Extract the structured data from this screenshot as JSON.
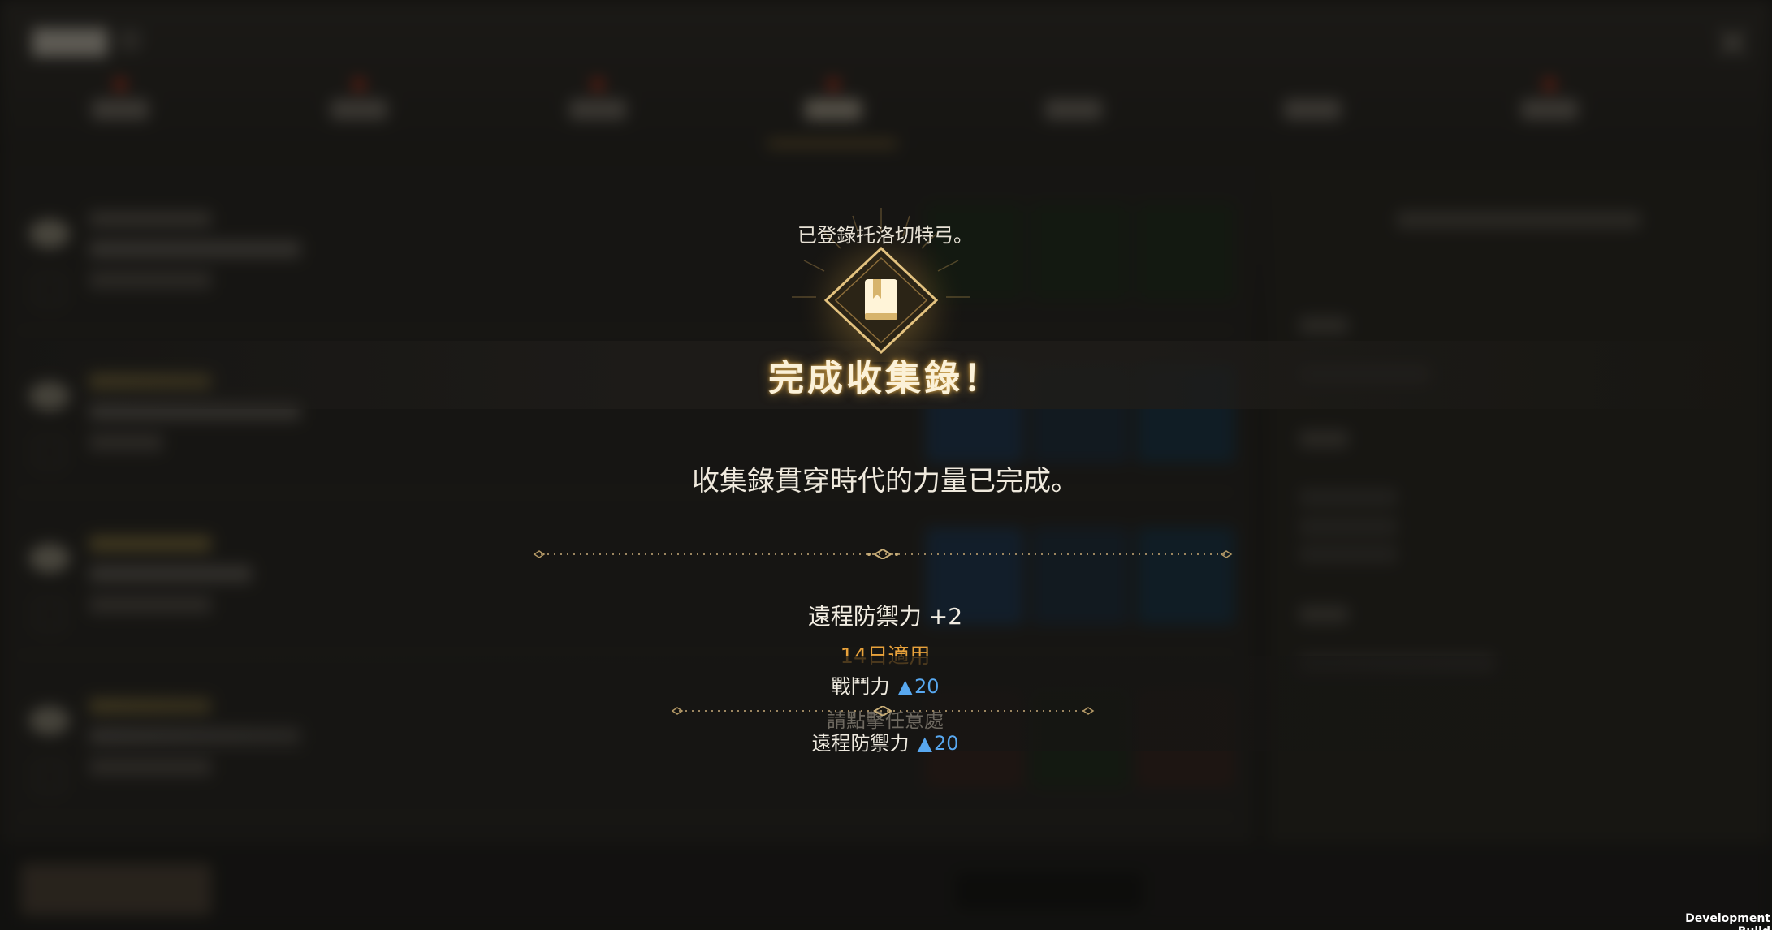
{
  "modal": {
    "notice": "已登錄托洛切特弓。",
    "banner_title": "完成收集錄！",
    "subtitle": "收集錄貫穿時代的力量已完成。",
    "stat_effect": "遠程防禦力 +2",
    "duration": "14日適用",
    "hint": "請點擊任意處",
    "stat_changes": [
      {
        "label": "戰鬥力",
        "arrow": "▲",
        "value": "20"
      },
      {
        "label": "遠程防禦力",
        "arrow": "▲",
        "value": "20"
      }
    ]
  },
  "overlay": {
    "build_label": "Development Build"
  },
  "icons": {
    "emblem": "book-icon"
  },
  "colors": {
    "accent_gold": "#e9a23b",
    "increase_blue": "#58a8f0",
    "notification_red": "#c3331c"
  }
}
